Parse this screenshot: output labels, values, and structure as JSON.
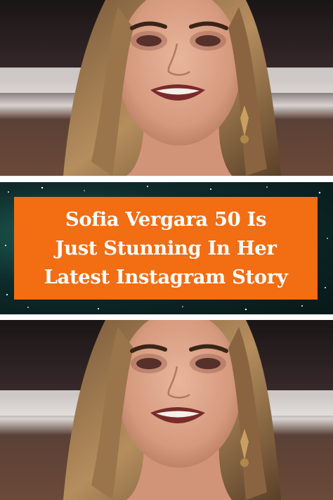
{
  "headline": {
    "line1": "Sofia Vergara 50 Is",
    "line2": "Just Stunning In Her",
    "line3": "Latest Instagram Story"
  },
  "colors": {
    "banner_box": "#f36d12",
    "banner_text": "#ffffff",
    "banner_background": "#0e2a2a"
  }
}
